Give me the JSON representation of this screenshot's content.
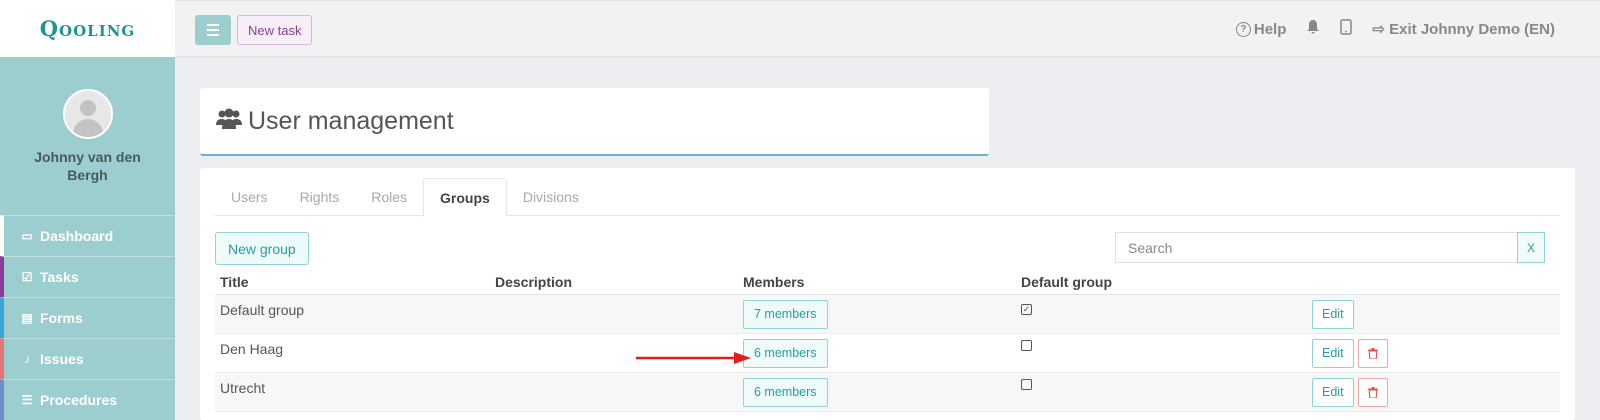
{
  "brand": {
    "logo": "Qooling"
  },
  "profile": {
    "name": "Johnny van den Bergh"
  },
  "sidebar": {
    "items": [
      {
        "label": "Dashboard",
        "icon": "monitor-icon",
        "accent": "#ffffff"
      },
      {
        "label": "Tasks",
        "icon": "check-square-icon",
        "accent": "#8a3c98"
      },
      {
        "label": "Forms",
        "icon": "file-icon",
        "accent": "#3aa6d6"
      },
      {
        "label": "Issues",
        "icon": "bell-icon",
        "accent": "#e0787a"
      },
      {
        "label": "Procedures",
        "icon": "list-icon",
        "accent": "#6d8fc7"
      }
    ]
  },
  "topbar": {
    "new_task": "New task",
    "help": "Help",
    "exit": "Exit Johnny Demo (EN)"
  },
  "page": {
    "title": "User management"
  },
  "tabs": [
    "Users",
    "Rights",
    "Roles",
    "Groups",
    "Divisions"
  ],
  "active_tab": "Groups",
  "toolbar": {
    "new_group": "New group",
    "search_placeholder": "Search",
    "clear": "X"
  },
  "table": {
    "headers": {
      "title": "Title",
      "description": "Description",
      "members": "Members",
      "default": "Default group"
    },
    "rows": [
      {
        "title": "Default group",
        "description": "",
        "members": "7 members",
        "default": true,
        "edit": "Edit",
        "deletable": false
      },
      {
        "title": "Den Haag",
        "description": "",
        "members": "6 members",
        "default": false,
        "edit": "Edit",
        "deletable": true
      },
      {
        "title": "Utrecht",
        "description": "",
        "members": "6 members",
        "default": false,
        "edit": "Edit",
        "deletable": true
      }
    ]
  },
  "colors": {
    "accent": "#2a9ca2",
    "sidebar": "#9ccdcf",
    "annotation_arrow": "#e02020"
  }
}
